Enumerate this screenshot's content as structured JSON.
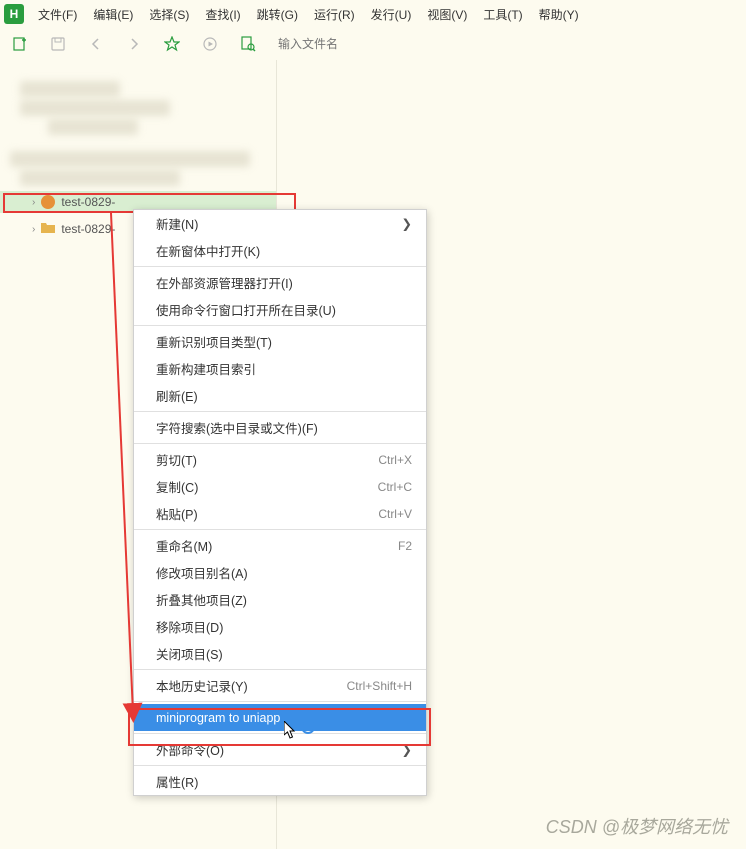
{
  "app": {
    "icon_letter": "H"
  },
  "menubar": {
    "items": [
      "文件(F)",
      "编辑(E)",
      "选择(S)",
      "查找(I)",
      "跳转(G)",
      "运行(R)",
      "发行(U)",
      "视图(V)",
      "工具(T)",
      "帮助(Y)"
    ]
  },
  "toolbar": {
    "search_placeholder": "输入文件名"
  },
  "sidebar": {
    "project1": "test-0829-",
    "project2": "test-0829-"
  },
  "context_menu": {
    "items": [
      {
        "label": "新建(N)",
        "arrow": true
      },
      {
        "label": "在新窗体中打开(K)"
      },
      {
        "sep": true
      },
      {
        "label": "在外部资源管理器打开(I)"
      },
      {
        "label": "使用命令行窗口打开所在目录(U)"
      },
      {
        "sep": true
      },
      {
        "label": "重新识别项目类型(T)"
      },
      {
        "label": "重新构建项目索引"
      },
      {
        "label": "刷新(E)"
      },
      {
        "sep": true
      },
      {
        "label": "字符搜索(选中目录或文件)(F)"
      },
      {
        "sep": true
      },
      {
        "label": "剪切(T)",
        "shortcut": "Ctrl+X"
      },
      {
        "label": "复制(C)",
        "shortcut": "Ctrl+C"
      },
      {
        "label": "粘贴(P)",
        "shortcut": "Ctrl+V"
      },
      {
        "sep": true
      },
      {
        "label": "重命名(M)",
        "shortcut": "F2"
      },
      {
        "label": "修改项目别名(A)"
      },
      {
        "label": "折叠其他项目(Z)"
      },
      {
        "label": "移除项目(D)"
      },
      {
        "label": "关闭项目(S)"
      },
      {
        "sep": true
      },
      {
        "label": "本地历史记录(Y)",
        "shortcut": "Ctrl+Shift+H"
      },
      {
        "sep": true
      },
      {
        "label": "miniprogram to uniapp",
        "hl": true
      },
      {
        "sep": true
      },
      {
        "label": "外部命令(O)",
        "arrow": true
      },
      {
        "sep": true
      },
      {
        "label": "属性(R)"
      }
    ]
  },
  "watermark": "CSDN @极梦网络无忧"
}
